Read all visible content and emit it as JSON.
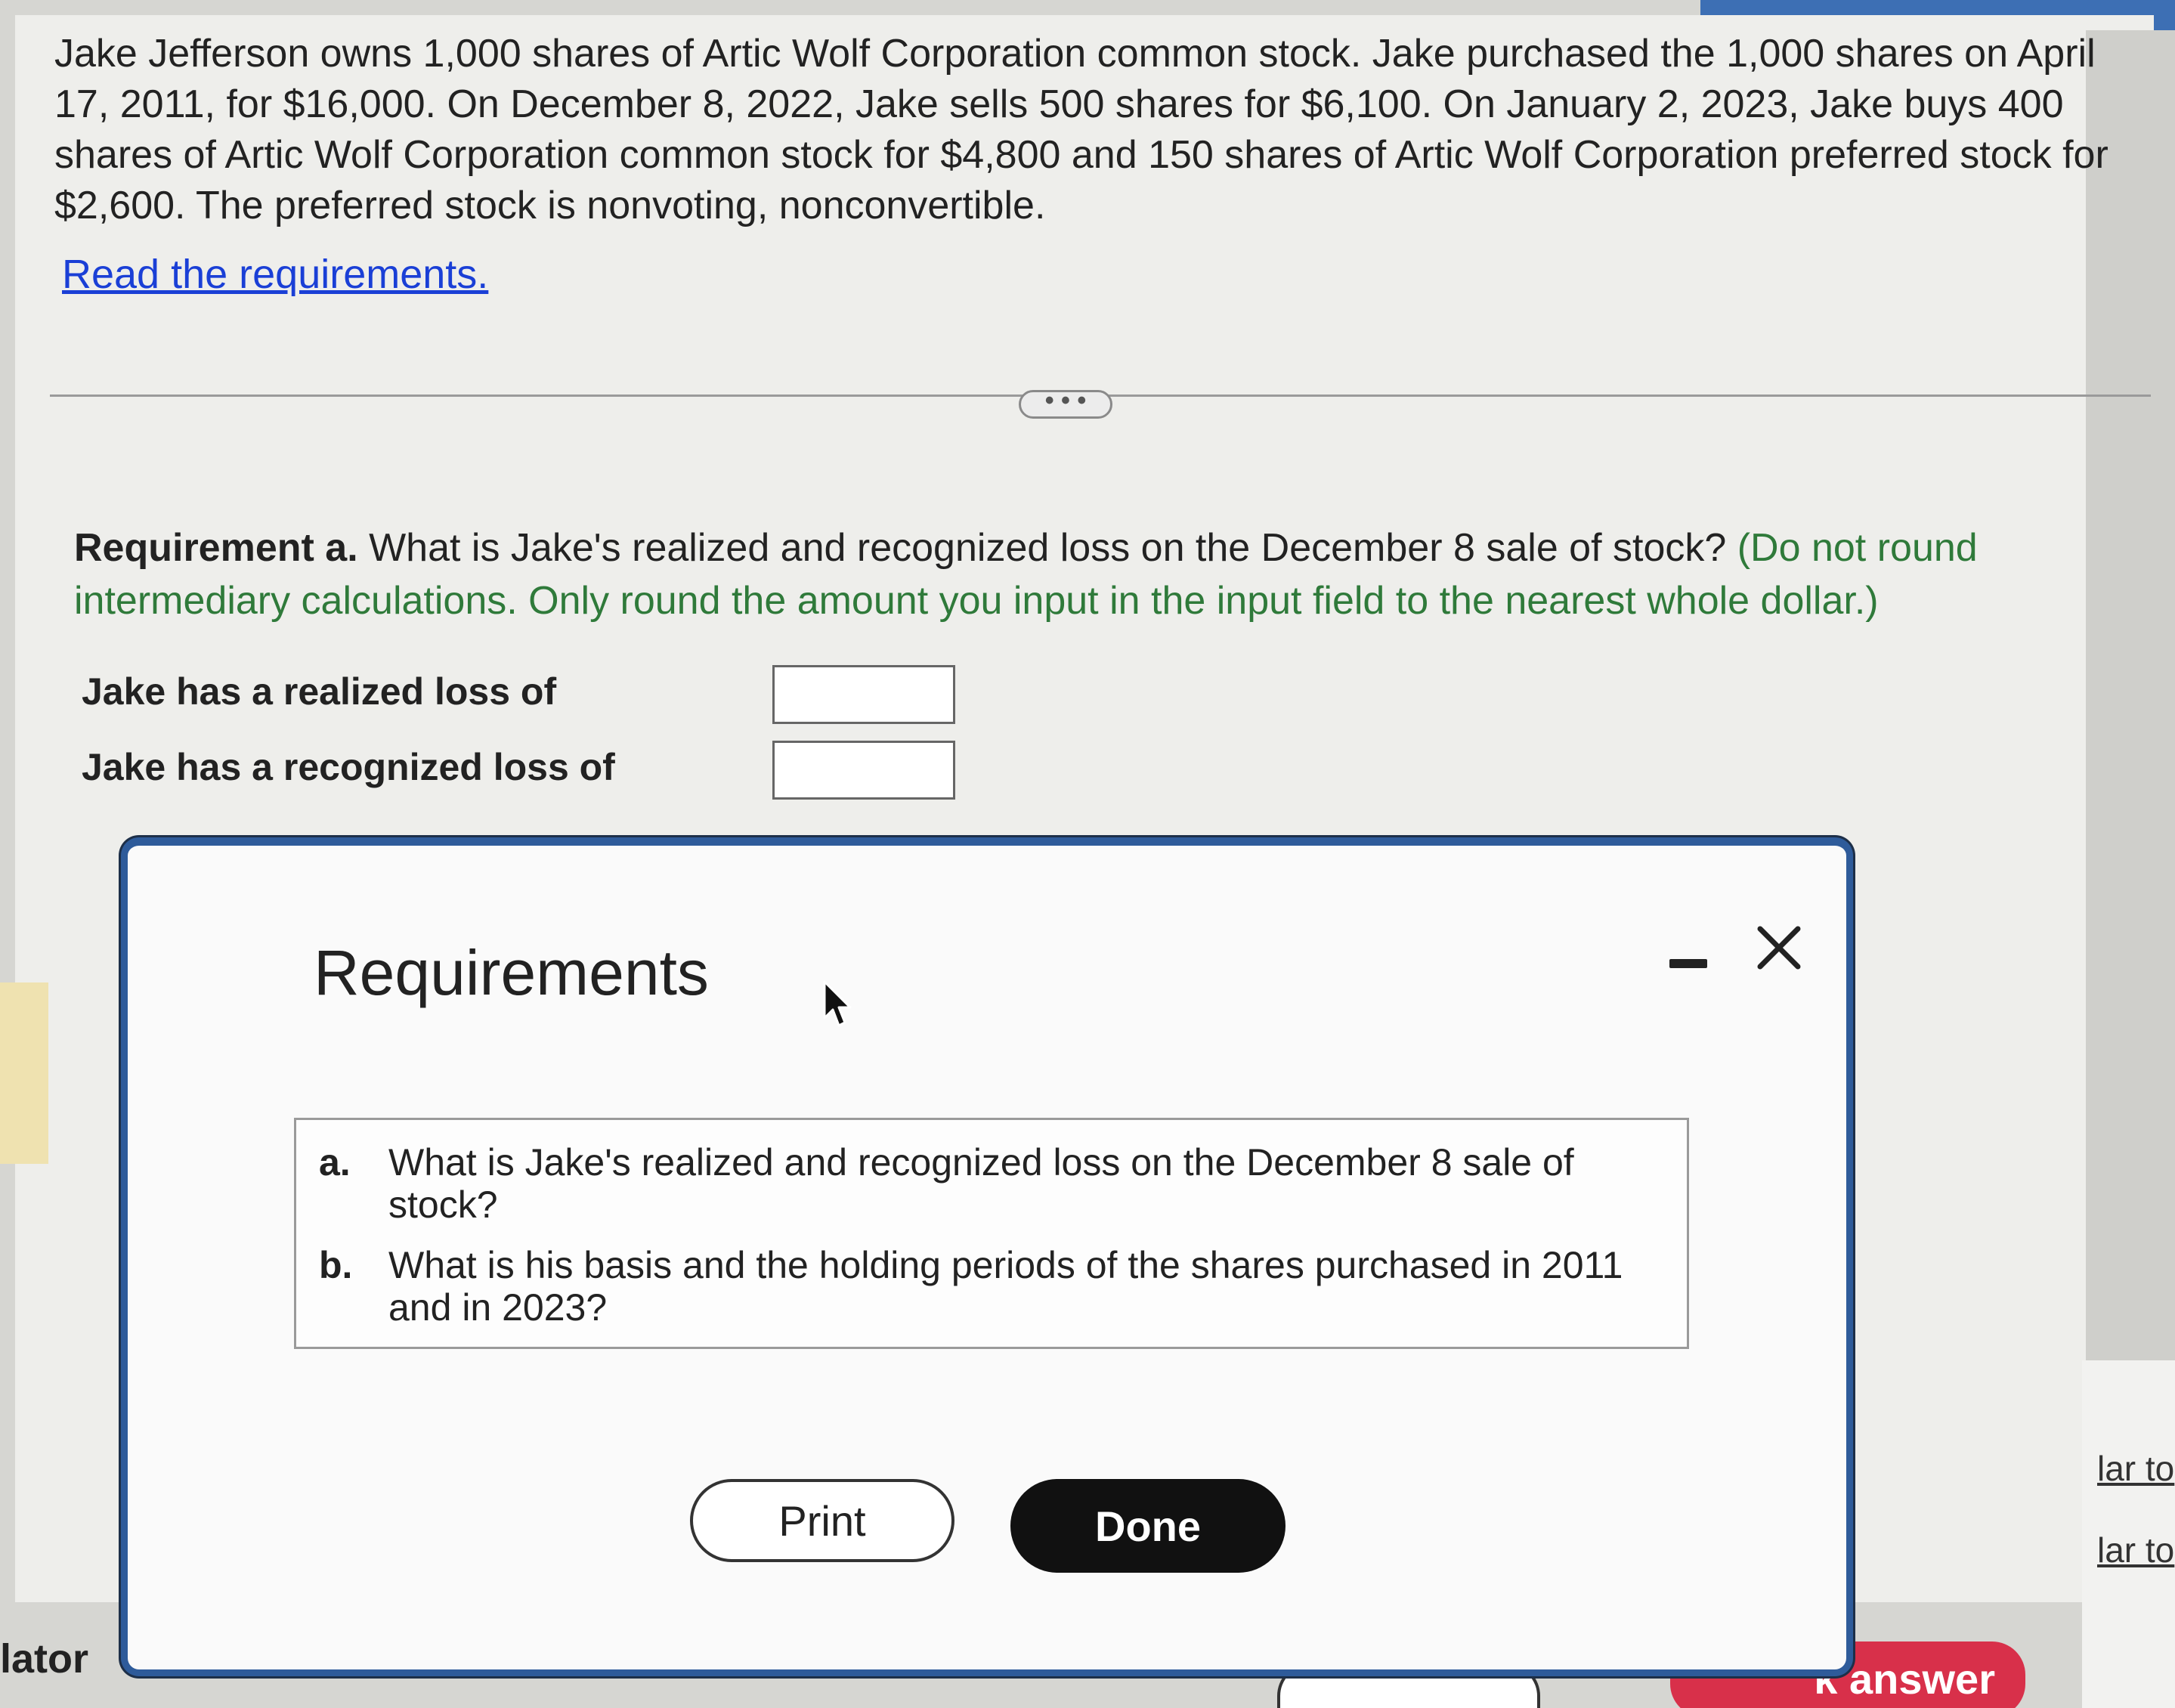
{
  "problem": {
    "text": "Jake Jefferson owns 1,000 shares of Artic Wolf Corporation common stock. Jake purchased the 1,000 shares on April 17, 2011, for $16,000. On December 8, 2022, Jake sells 500 shares for $6,100. On January 2, 2023, Jake buys 400 shares of Artic Wolf Corporation common stock for $4,800 and 150 shares of Artic Wolf Corporation preferred stock for $2,600. The preferred stock is nonvoting, nonconvertible.",
    "read_requirements_link": "Read the requirements."
  },
  "divider": {
    "ellipsis": "• • •"
  },
  "requirement_a": {
    "label": "Requirement a.",
    "question": " What is Jake's realized and recognized loss on the December 8 sale of stock? ",
    "note": "(Do not round intermediary calculations. Only round the amount you input in the input field to the nearest whole dollar.)",
    "realized_label": "Jake has a realized loss of",
    "realized_value": "",
    "recognized_label": "Jake has a recognized loss of",
    "recognized_value": ""
  },
  "modal": {
    "title": "Requirements",
    "items": [
      {
        "letter": "a.",
        "text": "What is Jake's realized and recognized loss on the December 8 sale of stock?"
      },
      {
        "letter": "b.",
        "text": "What is his basis and the holding periods of the shares purchased in 2011 and in 2023?"
      }
    ],
    "print_label": "Print",
    "done_label": "Done"
  },
  "background": {
    "left_fragment": "lator",
    "right_fragment_1": "lar to",
    "right_fragment_2": "lar to",
    "check_answer_fragment": "k answer"
  },
  "colors": {
    "link": "#1a3fd6",
    "note_green": "#2f7a3a",
    "modal_border": "#2e5b9a",
    "check_answer": "#d8304a",
    "done_button": "#111111"
  }
}
